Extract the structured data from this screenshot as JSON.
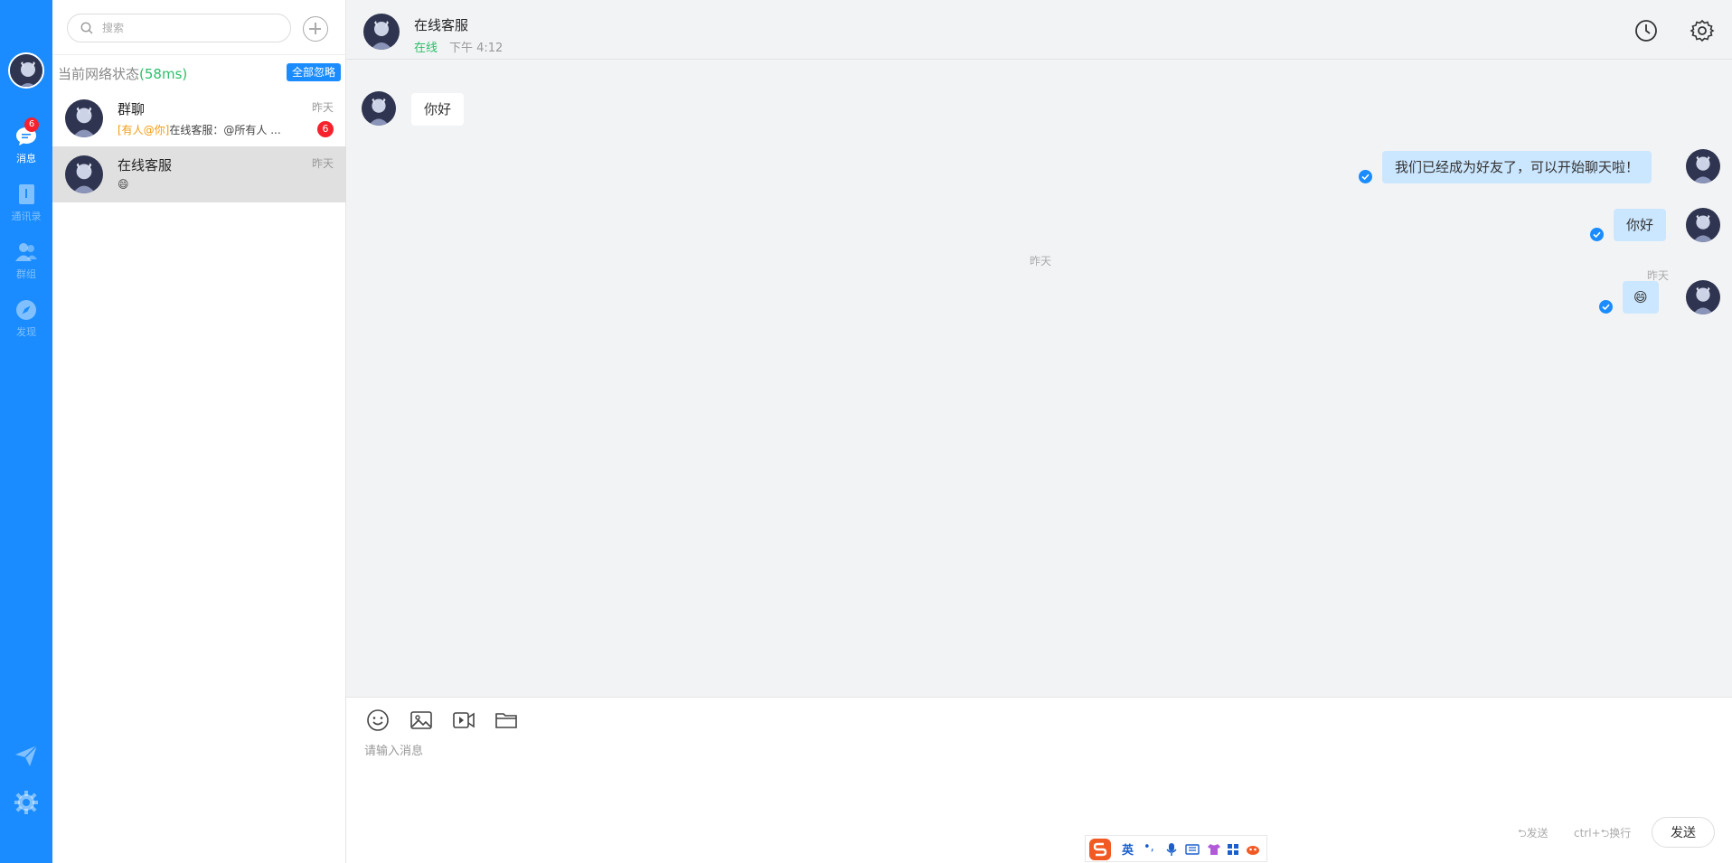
{
  "nav": {
    "messages_label": "消息",
    "messages_badge": "6",
    "contacts_label": "通讯录",
    "groups_label": "群组",
    "discover_label": "发现"
  },
  "list": {
    "search_placeholder": "搜索",
    "network_label": "当前网络状态",
    "network_ms": "(58ms)",
    "ignore_all": "全部忽略",
    "conversations": [
      {
        "name": "群聊",
        "time": "昨天",
        "mention": "[有人@你]",
        "preview": "在线客服：@所有人 ...",
        "badge": "6"
      },
      {
        "name": "在线客服",
        "time": "昨天",
        "mention": "",
        "preview": "😄",
        "badge": ""
      }
    ]
  },
  "chat": {
    "name": "在线客服",
    "status": "在线",
    "last_time": "下午 4:12",
    "messages": [
      {
        "direction": "in",
        "text": "你好"
      },
      {
        "direction": "out",
        "text": "我们已经成为好友了，可以开始聊天啦！"
      },
      {
        "direction": "out",
        "text": "你好"
      },
      {
        "direction": "out",
        "text": "😄",
        "time": "昨天"
      }
    ],
    "center_time": "昨天"
  },
  "composer": {
    "placeholder": "请输入消息",
    "hint_send": "⮌发送",
    "hint_newline": "ctrl+⮌换行",
    "send_label": "发送"
  },
  "ime": {
    "lang": "英",
    "punct": "•,"
  },
  "colors": {
    "brand": "#1a8cff",
    "online": "#2cbf6a",
    "badge": "#f5222d",
    "out_bubble": "#cbe7ff"
  }
}
